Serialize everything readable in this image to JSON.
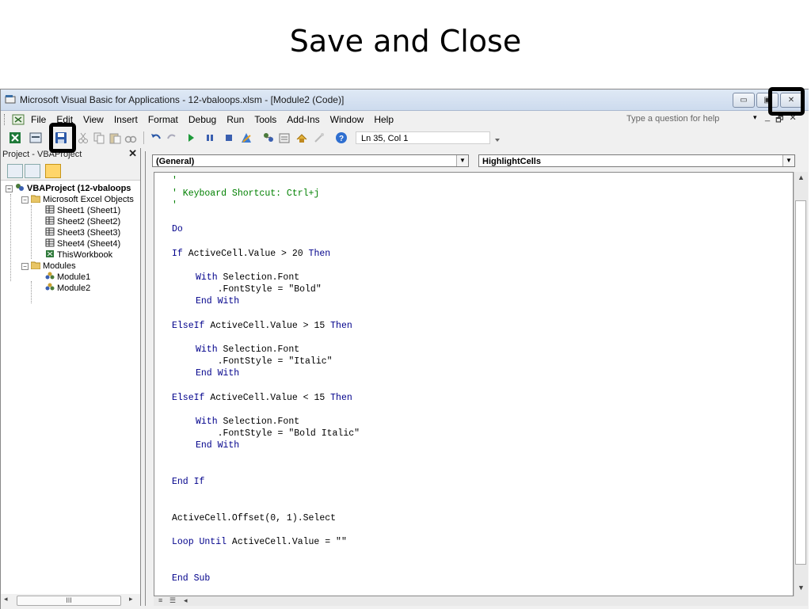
{
  "slide": {
    "title": "Save and Close"
  },
  "window": {
    "title": "Microsoft Visual Basic for Applications - 12-vbaloops.xlsm - [Module2 (Code)]",
    "buttons": {
      "minimize": "▭",
      "maximize": "▣",
      "close": "✕"
    }
  },
  "menu": {
    "items": [
      "File",
      "Edit",
      "View",
      "Insert",
      "Format",
      "Debug",
      "Run",
      "Tools",
      "Add-Ins",
      "Window",
      "Help"
    ],
    "help_placeholder": "Type a question for help",
    "mdi": {
      "minimize": "_",
      "restore": "🗗",
      "close": "✕"
    }
  },
  "toolbar": {
    "position": "Ln 35, Col 1"
  },
  "project": {
    "header": "Project - VBAProject",
    "close": "✕",
    "tree": {
      "root": "VBAProject (12-vbaloops",
      "excel_objects": "Microsoft Excel Objects",
      "sheets": [
        "Sheet1 (Sheet1)",
        "Sheet2 (Sheet2)",
        "Sheet3 (Sheet3)",
        "Sheet4 (Sheet4)"
      ],
      "workbook": "ThisWorkbook",
      "modules_folder": "Modules",
      "modules": [
        "Module1",
        "Module2"
      ]
    },
    "scroll_thumb": "III"
  },
  "code": {
    "object_dropdown": "(General)",
    "procedure_dropdown": "HighlightCells",
    "lines": {
      "l1": "'",
      "l2": "' Keyboard Shortcut: Ctrl+j",
      "l3": "'",
      "do": "Do",
      "if1_kw": "If",
      "if1_mid": " ActiveCell.Value > 20 ",
      "if1_then": "Then",
      "with1_kw": "With",
      "with1_rest": " Selection.Font",
      "font1": "    .FontStyle = \"Bold\"",
      "endwith1": "End With",
      "elseif1_kw": "ElseIf",
      "elseif1_mid": " ActiveCell.Value > 15 ",
      "elseif1_then": "Then",
      "with2_kw": "With",
      "with2_rest": " Selection.Font",
      "font2": "    .FontStyle = \"Italic\"",
      "endwith2": "End With",
      "elseif2_kw": "ElseIf",
      "elseif2_mid": " ActiveCell.Value < 15 ",
      "elseif2_then": "Then",
      "with3_kw": "With",
      "with3_rest": " Selection.Font",
      "font3": "    .FontStyle = \"Bold Italic\"",
      "endwith3": "End With",
      "endif": "End If",
      "offset": "ActiveCell.Offset(0, 1).Select",
      "loop_kw": "Loop Until",
      "loop_rest": " ActiveCell.Value = \"\"",
      "endsub": "End Sub"
    }
  }
}
